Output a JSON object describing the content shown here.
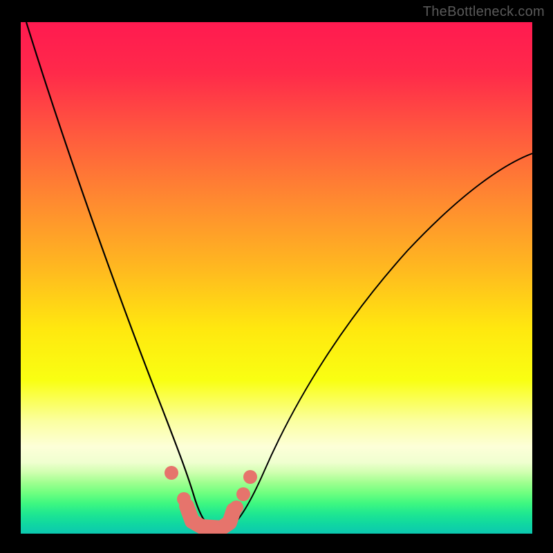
{
  "watermark": "TheBottleneck.com",
  "colors": {
    "gradient_top": "#ff1a50",
    "gradient_mid": "#ffe80f",
    "gradient_bottom": "#0cc8b0",
    "curve_stroke": "#000000",
    "marker_fill": "#e6746c",
    "background": "#000000"
  },
  "chart_data": {
    "type": "line",
    "title": "",
    "xlabel": "",
    "ylabel": "",
    "xlim": [
      0,
      100
    ],
    "ylim": [
      0,
      100
    ],
    "series": [
      {
        "name": "bottleneck-curve",
        "x": [
          1,
          4,
          8,
          12,
          16,
          20,
          24,
          27,
          30,
          32,
          34,
          36,
          38,
          40,
          42,
          44,
          48,
          54,
          60,
          68,
          76,
          84,
          92,
          100
        ],
        "y": [
          100,
          88,
          76,
          64,
          52,
          40,
          29,
          21,
          14,
          10,
          6,
          3,
          1,
          0,
          1,
          3,
          8,
          17,
          26,
          36,
          46,
          54,
          61,
          67
        ]
      }
    ],
    "markers": {
      "name": "highlight-dots",
      "x": [
        30.5,
        33.0,
        43.0,
        44.5,
        45.8
      ],
      "y": [
        11.5,
        6.5,
        4.5,
        7.2,
        10.5
      ]
    },
    "u_segment": {
      "x": [
        33.5,
        34.5,
        36.5,
        40.0,
        41.5,
        42.2
      ],
      "y": [
        4.8,
        1.8,
        0.8,
        0.8,
        1.8,
        4.0
      ]
    }
  }
}
